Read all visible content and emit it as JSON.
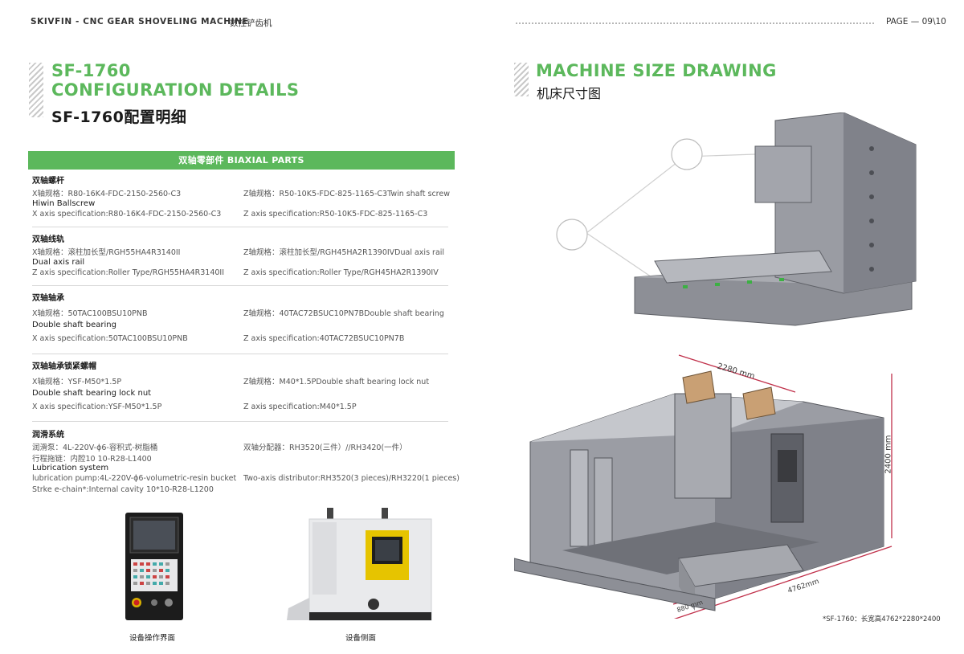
{
  "header": {
    "brand": "SKIVFIN - CNC GEAR SHOVELING MACHINE",
    "brand_cn": "数控铲齿机",
    "page": "PAGE — 09\\10"
  },
  "left": {
    "title_line1": "SF-1760",
    "title_line2": "CONFIGURATION DETAILS",
    "title_cn": "SF-1760配置明细",
    "parts_bar": "双轴零部件 BIAXIAL PARTS",
    "sections": [
      {
        "heading_cn": "双轴螺杆",
        "x_cn": "X轴规格：R80-16K4-FDC-2150-2560-C3",
        "z_cn": "Z轴规格：R50-10K5-FDC-825-1165-C3Twin shaft screw",
        "heading_en": "Hiwin Ballscrew",
        "x_en": "X axis specification:R80-16K4-FDC-2150-2560-C3",
        "z_en": "Z axis specification:R50-10K5-FDC-825-1165-C3"
      },
      {
        "heading_cn": "双轴线轨",
        "x_cn": "X轴规格：滚柱加长型/RGH55HA4R3140II",
        "z_cn": "Z轴规格：滚柱加长型/RGH45HA2R1390IVDual axis rail",
        "heading_en": "Dual axis rail",
        "x_en": "Z axis specification:Roller Type/RGH55HA4R3140II",
        "z_en": "Z axis specification:Roller Type/RGH45HA2R1390IV"
      },
      {
        "heading_cn": "双轴轴承",
        "x_cn": "X轴规格：50TAC100BSU10PNB",
        "z_cn": "Z轴规格：40TAC72BSUC10PN7BDouble shaft bearing",
        "heading_en": "Double shaft bearing",
        "x_en": "X axis specification:50TAC100BSU10PNB",
        "z_en": "Z axis specification:40TAC72BSUC10PN7B"
      },
      {
        "heading_cn": "双轴轴承锁紧螺帽",
        "x_cn": "X轴规格：YSF-M50*1.5P",
        "z_cn": "Z轴规格：M40*1.5PDouble shaft bearing lock nut",
        "heading_en": "Double shaft bearing lock nut",
        "x_en": "X axis specification:YSF-M50*1.5P",
        "z_en": "Z axis specification:M40*1.5P"
      }
    ],
    "lube": {
      "heading_cn": "润滑系统",
      "line1_cn": "润滑泵：4L-220V-ϕ6-容积式-树脂桶",
      "line2_cn": "行程拖链：内腔10 10-R28-L1400",
      "right_cn": "双轴分配器：RH3520(三件）//RH3420(一件）",
      "heading_en": "Lubrication system",
      "line1_en": "lubrication pump:4L-220V-ϕ6-volumetric-resin bucket",
      "line2_en": "Strke e-chain*:Internal cavity 10*10-R28-L1200",
      "right_en": "Two-axis distributor:RH3520(3 pieces)/RH3220(1 pieces)"
    },
    "photos": {
      "caption1": "设备操作界面",
      "caption2": "设备侧面"
    }
  },
  "right": {
    "title": "MACHINE SIZE DRAWING",
    "title_cn": "机床尺寸图",
    "dim_width": "2280 mm",
    "dim_height": "2400 mm",
    "dim_length": "4762mm",
    "dim_step": "880 mm",
    "note": "*SF-1760：长宽高4762*2280*2400"
  },
  "colors": {
    "accent": "#5cb85c",
    "dim_line": "#c0304a",
    "machine_gray": "#8a8a90"
  }
}
